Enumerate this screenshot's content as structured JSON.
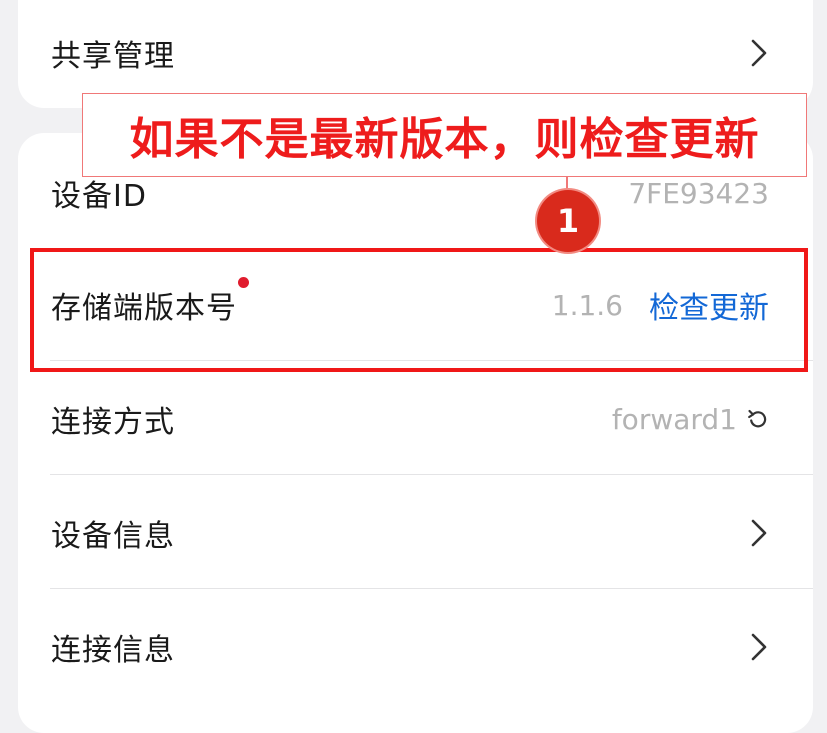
{
  "rows": {
    "share_manage": {
      "label": "共享管理"
    },
    "device_id": {
      "label": "设备ID",
      "value": "7FE93423"
    },
    "storage_version": {
      "label": "存储端版本号",
      "value": "1.1.6",
      "action": "检查更新"
    },
    "connection_mode": {
      "label": "连接方式",
      "value": "forward1"
    },
    "device_info": {
      "label": "设备信息"
    },
    "connection_info": {
      "label": "连接信息"
    }
  },
  "annotation": {
    "callout_text": "如果不是最新版本，则检查更新",
    "badge_number": "1"
  },
  "icons": {
    "chevron": "chevron-right-icon",
    "refresh": "refresh-icon",
    "update_dot": "red-dot-indicator"
  },
  "colors": {
    "background": "#f1f1f3",
    "card": "#ffffff",
    "link": "#1368d6",
    "annotation_red": "#f01818",
    "badge_red": "#d92a1c",
    "secondary_text": "#b3b3b3"
  }
}
